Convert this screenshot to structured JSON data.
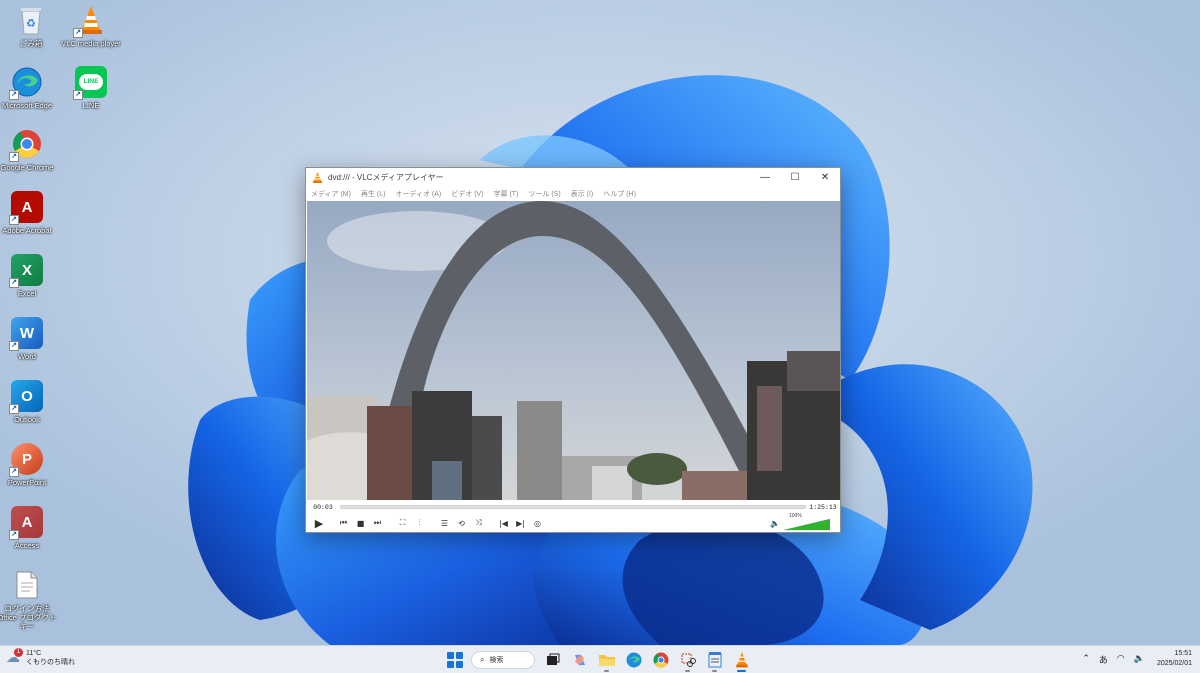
{
  "desktop": {
    "icons": [
      {
        "label": "ごみ箱",
        "icon": "recycle-bin-icon"
      },
      {
        "label": "VLC media player",
        "icon": "vlc-cone-icon"
      },
      {
        "label": "Microsoft Edge",
        "icon": "edge-icon"
      },
      {
        "label": "LINE",
        "icon": "line-icon",
        "glyph": "LINE"
      },
      {
        "label": "Google Chrome",
        "icon": "chrome-icon"
      },
      {
        "label": "Adobe Acrobat",
        "icon": "acrobat-icon",
        "glyph": "A"
      },
      {
        "label": "Excel",
        "icon": "excel-icon",
        "glyph": "X"
      },
      {
        "label": "Word",
        "icon": "word-icon",
        "glyph": "W"
      },
      {
        "label": "Outlook",
        "icon": "outlook-icon",
        "glyph": "O"
      },
      {
        "label": "PowerPoint",
        "icon": "powerpoint-icon",
        "glyph": "P"
      },
      {
        "label": "Access",
        "icon": "access-icon",
        "glyph": "A"
      },
      {
        "label": "ログイン方法 Office プロダクトキー",
        "icon": "text-file-icon"
      }
    ]
  },
  "vlc": {
    "title": "dvd:/// - VLCメディアプレイヤー",
    "menu": [
      "メディア (M)",
      "再生 (L)",
      "オーディオ (A)",
      "ビデオ (V)",
      "字幕 (T)",
      "ツール (S)",
      "表示 (I)",
      "ヘルプ (H)"
    ],
    "elapsed": "00:03",
    "total": "1:25:13",
    "progress": 0.0,
    "volume_label": "100%",
    "volume": 1.0,
    "colors": {
      "volume_fill": "#2fb32f",
      "accent": "#ff8800"
    }
  },
  "taskbar": {
    "weather_temp": "11°C",
    "weather_desc": "くもりのち晴れ",
    "weather_badge": "1",
    "search_label": "検索",
    "ime_label": "あ",
    "time": "15:51",
    "date": "2025/02/01",
    "apps": [
      "task-view-icon",
      "copilot-icon",
      "file-explorer-icon",
      "edge-icon",
      "chrome-icon",
      "snipping-tool-icon",
      "notepad-icon",
      "vlc-cone-icon"
    ]
  }
}
